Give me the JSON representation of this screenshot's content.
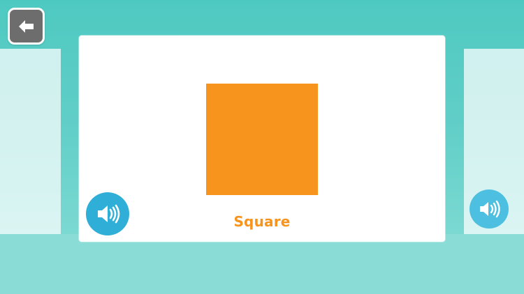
{
  "shape": {
    "label": "Square"
  },
  "colors": {
    "accent": "#f7941d",
    "sound_button": "#2fafd8",
    "back_button": "#6d6d6d",
    "background": "#62cfc8"
  },
  "icons": {
    "back": "back-arrow-icon",
    "sound": "speaker-icon"
  }
}
